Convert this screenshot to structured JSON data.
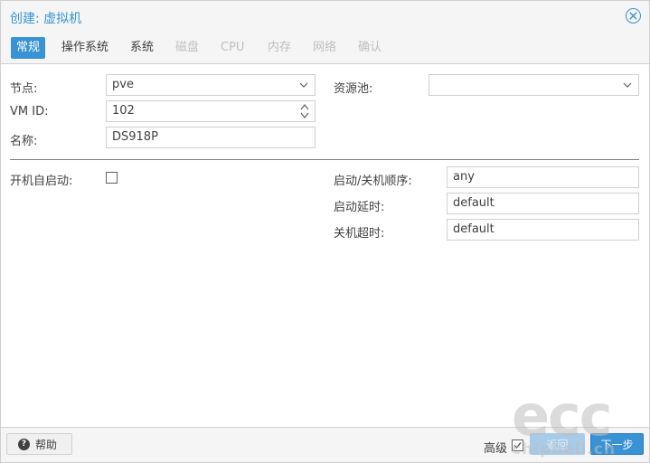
{
  "dialog": {
    "title": "创建: 虚拟机"
  },
  "tabs": [
    {
      "label": "常规",
      "state": "active"
    },
    {
      "label": "操作系统",
      "state": "enabled"
    },
    {
      "label": "系统",
      "state": "enabled"
    },
    {
      "label": "磁盘",
      "state": "disabled"
    },
    {
      "label": "CPU",
      "state": "disabled"
    },
    {
      "label": "内存",
      "state": "disabled"
    },
    {
      "label": "网络",
      "state": "disabled"
    },
    {
      "label": "确认",
      "state": "disabled"
    }
  ],
  "form": {
    "node": {
      "label": "节点:",
      "value": "pve"
    },
    "vmid": {
      "label": "VM ID:",
      "value": "102"
    },
    "name": {
      "label": "名称:",
      "value": "DS918P"
    },
    "pool": {
      "label": "资源池:",
      "value": ""
    },
    "onboot": {
      "label": "开机自启动:",
      "checked": false
    },
    "startup_order": {
      "label": "启动/关机顺序:",
      "placeholder": "any"
    },
    "startup_delay": {
      "label": "启动延时:",
      "placeholder": "default"
    },
    "shutdown_timeout": {
      "label": "关机超时:",
      "placeholder": "default"
    }
  },
  "footer": {
    "help_label": "帮助",
    "advanced_label": "高级",
    "advanced_checked": true,
    "back_label": "返回",
    "next_label": "下一步"
  },
  "watermark": {
    "big": "ecc",
    "small": "chiphell.cn"
  },
  "colors": {
    "accent": "#3892d4",
    "accent_disabled": "#a7cbe9",
    "panel_bg": "#f5f5f5",
    "border": "#cfcfcf",
    "text": "#404040",
    "text_disabled": "#bfbfbf"
  }
}
